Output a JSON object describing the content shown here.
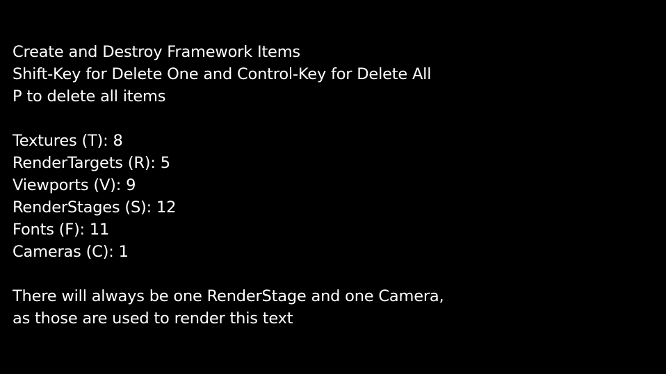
{
  "instructions": {
    "line1": "Create and Destroy Framework Items",
    "line2": "Shift-Key for Delete One and Control-Key for Delete All",
    "line3": "P to delete all items"
  },
  "counts": [
    {
      "label": "Textures (T): 8"
    },
    {
      "label": "RenderTargets (R): 5"
    },
    {
      "label": "Viewports (V): 9"
    },
    {
      "label": "RenderStages (S): 12"
    },
    {
      "label": "Fonts (F): 11"
    },
    {
      "label": "Cameras (C): 1"
    }
  ],
  "note": {
    "line1": "There will always be one RenderStage and one Camera,",
    "line2": "as those are used to render this text"
  },
  "colors": {
    "background": "#000000",
    "text": "#ffffff"
  }
}
